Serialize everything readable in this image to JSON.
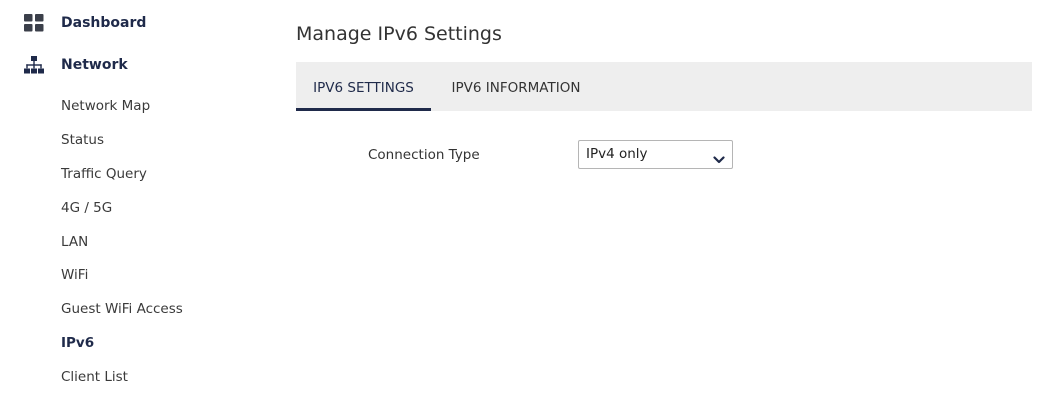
{
  "sidebar": {
    "dashboard": {
      "label": "Dashboard",
      "icon": "dashboard-grid-icon"
    },
    "network": {
      "label": "Network",
      "icon": "network-topology-icon"
    },
    "sub_items": [
      {
        "label": "Network Map"
      },
      {
        "label": "Status"
      },
      {
        "label": "Traffic Query"
      },
      {
        "label": "4G / 5G"
      },
      {
        "label": "LAN"
      },
      {
        "label": "WiFi"
      },
      {
        "label": "Guest WiFi Access"
      },
      {
        "label": "IPv6",
        "active": true
      },
      {
        "label": "Client List"
      }
    ]
  },
  "main": {
    "title": "Manage IPv6 Settings",
    "tabs": [
      {
        "label": "IPV6 SETTINGS",
        "active": true
      },
      {
        "label": "IPV6 INFORMATION",
        "active": false
      }
    ],
    "form": {
      "connection_type_label": "Connection Type",
      "connection_type_value": "IPv4 only"
    }
  },
  "colors": {
    "accent": "#1f2a4a",
    "tab_bar_bg": "#eeeeee"
  }
}
